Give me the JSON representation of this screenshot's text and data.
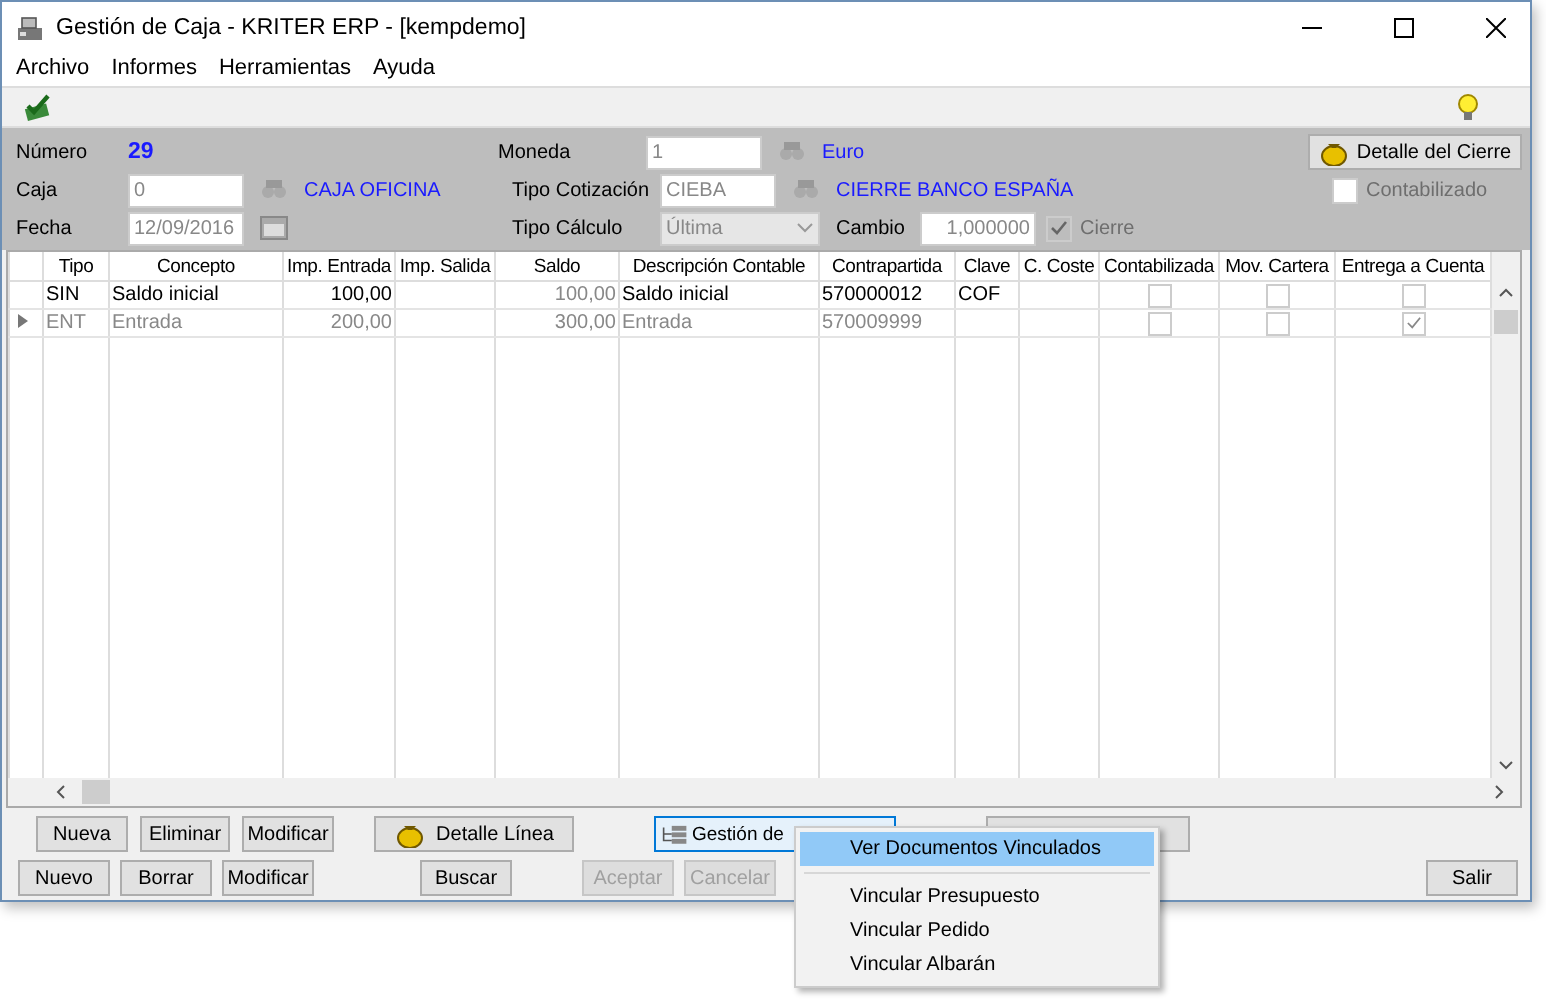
{
  "window": {
    "title": "Gestión de Caja - KRITER ERP - [kempdemo]"
  },
  "menu": [
    "Archivo",
    "Informes",
    "Herramientas",
    "Ayuda"
  ],
  "header": {
    "numero": {
      "label": "Número",
      "value": "29"
    },
    "moneda": {
      "label": "Moneda",
      "value": "1",
      "name": "Euro"
    },
    "caja": {
      "label": "Caja",
      "value": "0",
      "name": "CAJA OFICINA"
    },
    "tipo_cotizacion": {
      "label": "Tipo Cotización",
      "value": "CIEBA",
      "name": "CIERRE BANCO ESPAÑA"
    },
    "fecha": {
      "label": "Fecha",
      "value": "12/09/2016"
    },
    "tipo_calculo": {
      "label": "Tipo Cálculo",
      "value": "Última"
    },
    "cambio": {
      "label": "Cambio",
      "value": "1,000000"
    },
    "cierre": {
      "label": "Cierre",
      "checked": true,
      "disabled": true
    },
    "contabilizado": {
      "label": "Contabilizado",
      "checked": false,
      "disabled": true
    },
    "detalle_button": "Detalle del Cierre"
  },
  "table": {
    "columns": [
      "Tipo",
      "Concepto",
      "Imp. Entrada",
      "Imp. Salida",
      "Saldo",
      "Descripción Contable",
      "Contrapartida",
      "Clave",
      "C. Coste",
      "Contabilizada",
      "Mov. Cartera",
      "Entrega a Cuenta"
    ],
    "rows": [
      {
        "current": false,
        "dimmed": false,
        "tipo": "SIN",
        "concepto": "Saldo inicial",
        "imp_entrada": "100,00",
        "saldo": "100,00",
        "descripcion": "Saldo inicial",
        "contrapartida": "570000012",
        "clave": "COF",
        "contabilizada": false,
        "mov_cartera": false,
        "entrega_a_cuenta": false
      },
      {
        "current": true,
        "dimmed": true,
        "tipo": "ENT",
        "concepto": "Entrada",
        "imp_entrada": "200,00",
        "saldo": "300,00",
        "descripcion": "Entrada",
        "contrapartida": "570009999",
        "clave": "",
        "contabilizada": false,
        "mov_cartera": false,
        "entrega_a_cuenta": true
      }
    ]
  },
  "line_buttons": [
    {
      "label": "Nueva",
      "kind": "plain"
    },
    {
      "label": "Eliminar",
      "kind": "plain"
    },
    {
      "label": "Modificar",
      "kind": "plain"
    },
    {
      "label": "Detalle Línea",
      "kind": "money"
    },
    {
      "label": "Gestión de",
      "kind": "docs"
    },
    {
      "kind": "hidden"
    }
  ],
  "bottom_buttons": [
    {
      "label": "Nuevo",
      "disabled": false
    },
    {
      "label": "Borrar",
      "disabled": false
    },
    {
      "label": "Modificar",
      "disabled": false
    },
    {
      "label": "Buscar",
      "disabled": false
    },
    {
      "label": "Aceptar",
      "disabled": true
    },
    {
      "label": "Cancelar",
      "disabled": true
    },
    {
      "label": "Salir",
      "disabled": false
    }
  ],
  "popup_menu": [
    {
      "kind": "item",
      "label": "Ver Documentos Vinculados",
      "selected": true
    },
    {
      "kind": "separator"
    },
    {
      "kind": "item",
      "label": "Vincular Presupuesto",
      "selected": false
    },
    {
      "kind": "item",
      "label": "Vincular Pedido",
      "selected": false
    },
    {
      "kind": "item",
      "label": "Vincular Albarán",
      "selected": false
    }
  ]
}
